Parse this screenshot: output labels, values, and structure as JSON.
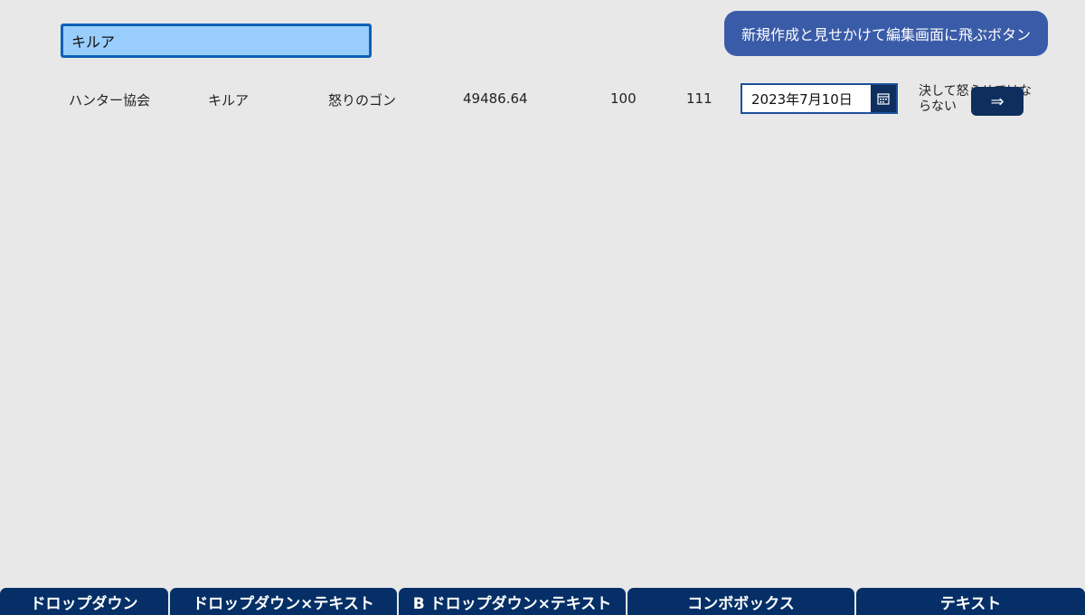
{
  "search": {
    "value": "キルア"
  },
  "new_button_label": "新規作成と見せかけて編集画面に飛ぶボタン",
  "row": {
    "organization": "ハンター協会",
    "name": "キルア",
    "text": "怒りのゴン",
    "amount": "49486.64",
    "value1": "100",
    "value2": "111",
    "date": "2023年7月10日",
    "note": "決して怒らせてはならない",
    "arrow_label": "⇒"
  },
  "tabs": [
    {
      "label": "ドロップダウン"
    },
    {
      "label": "ドロップダウン×テキスト"
    },
    {
      "label": "B ドロップダウン×テキスト"
    },
    {
      "label": "コンボボックス"
    },
    {
      "label": "テキスト"
    }
  ],
  "colors": {
    "background": "#e8e8e8",
    "search_fill": "#99cdfb",
    "search_border": "#0d61b8",
    "primary_button": "#3a5ba8",
    "dark_navy": "#052f66"
  },
  "icons": {
    "calendar": "calendar-icon",
    "arrow": "arrow-right-icon"
  }
}
